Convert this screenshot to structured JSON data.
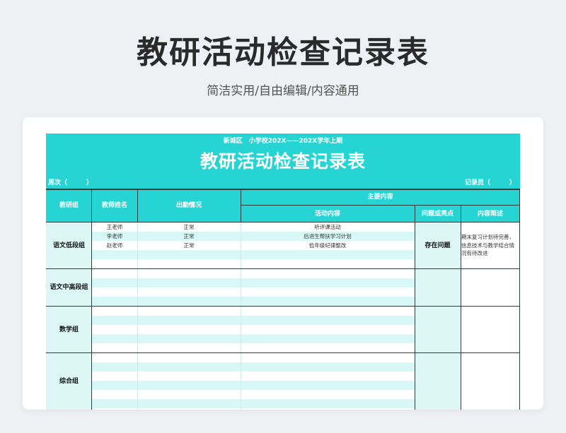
{
  "page": {
    "title": "教研活动检查记录表",
    "subtitle": "简洁实用/自由编辑/内容通用"
  },
  "sheet": {
    "org_line": "新城区　小学校202X——202X学年上期",
    "title": "教研活动检查记录表",
    "week_label": "周次（　　　）",
    "recorder_label": "记录员（　　　）",
    "headers": {
      "group": "教研组",
      "teacher": "教师姓名",
      "attendance": "出勤情况",
      "main_content": "主要内容",
      "activity": "活动内容",
      "problem": "问题或亮点",
      "summary": "内容简述"
    },
    "groups": [
      {
        "name": "语文低段组",
        "rows": [
          {
            "teacher": "王老师",
            "attendance": "正常",
            "activity": "听评课活动"
          },
          {
            "teacher": "李老师",
            "attendance": "正常",
            "activity": "后进生帮扶学习计划"
          },
          {
            "teacher": "赵老师",
            "attendance": "正常",
            "activity": "低年级纪律整改"
          }
        ],
        "problem": "存在问题",
        "summary": "期末复习计划待完善，信息技术与教学结合情况有待改进"
      },
      {
        "name": "语文中高段组"
      },
      {
        "name": "数学组"
      },
      {
        "name": "综合组"
      }
    ],
    "colors": {
      "accent": "#26d4d3",
      "stripe": "#d8f7f7",
      "grid": "#2c3e3e"
    }
  }
}
